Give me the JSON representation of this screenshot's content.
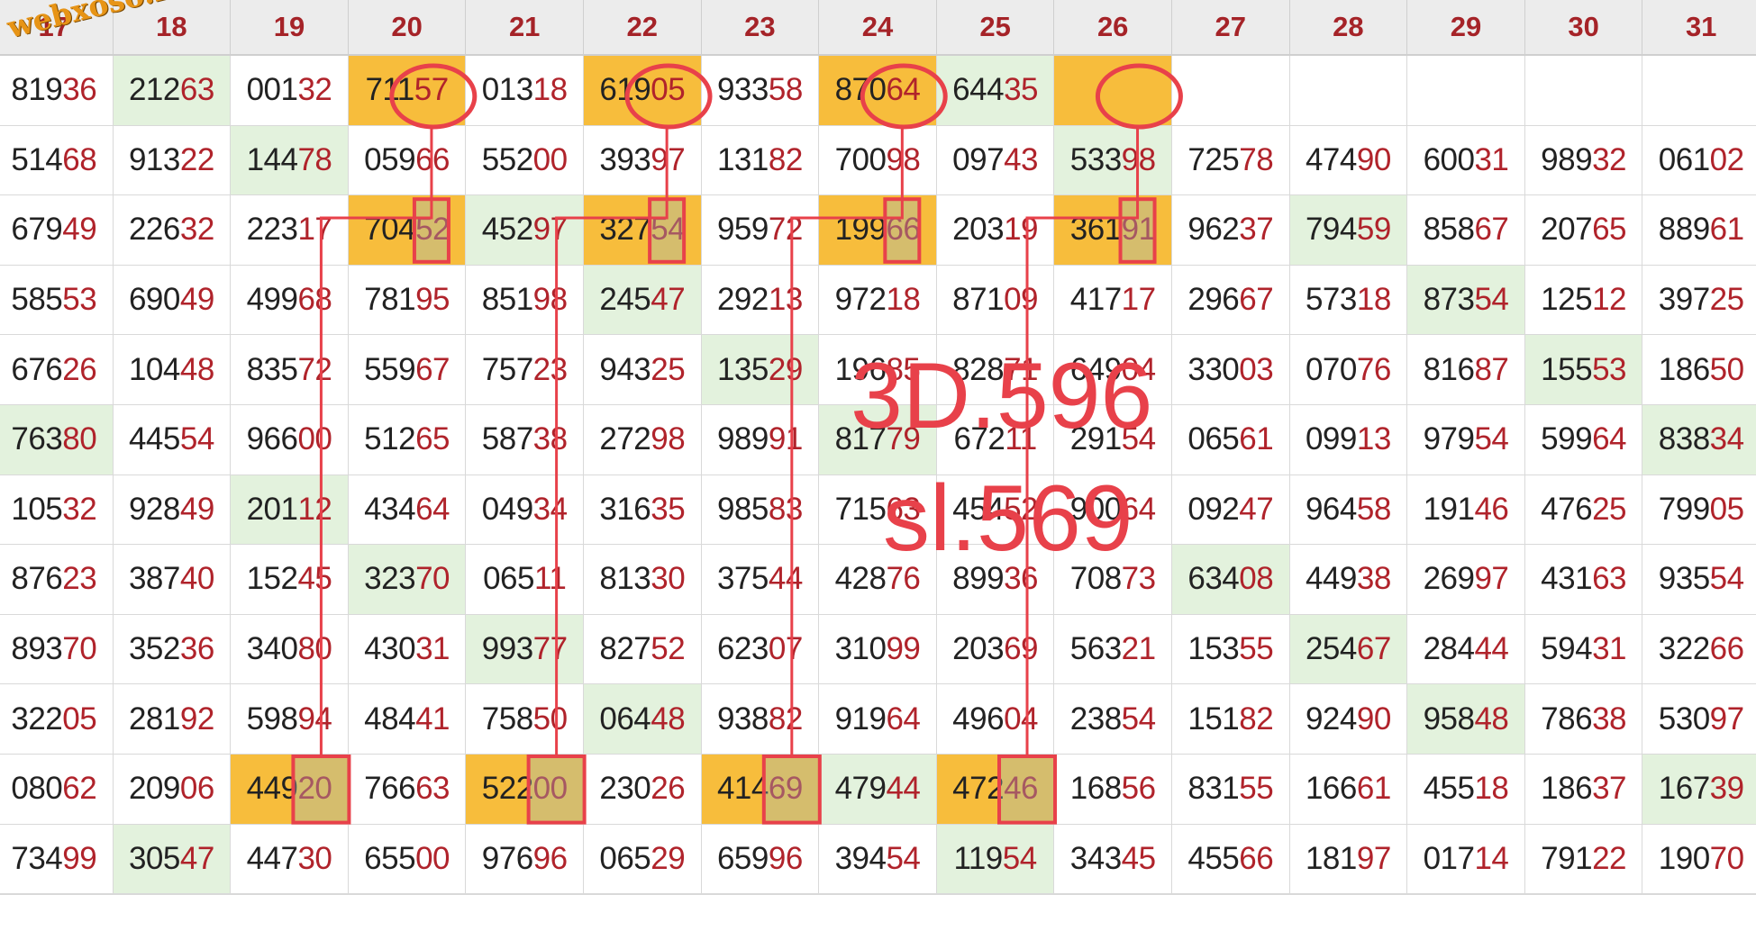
{
  "columns": [
    "17",
    "18",
    "19",
    "20",
    "21",
    "22",
    "23",
    "24",
    "25",
    "26",
    "27",
    "28",
    "29",
    "30",
    "31"
  ],
  "rows": [
    [
      "81936",
      "21263",
      "00132",
      "71157",
      "01318",
      "61905",
      "93358",
      "87064",
      "64435",
      "",
      "",
      "",
      "",
      "",
      ""
    ],
    [
      "51468",
      "91322",
      "14478",
      "05966",
      "55200",
      "39397",
      "13182",
      "70098",
      "09743",
      "53398",
      "72578",
      "47490",
      "60031",
      "98932",
      "06102"
    ],
    [
      "67949",
      "22632",
      "22317",
      "70452",
      "45297",
      "32754",
      "95972",
      "19966",
      "20319",
      "36191",
      "96237",
      "79459",
      "85867",
      "20765",
      "88961"
    ],
    [
      "58553",
      "69049",
      "49968",
      "78195",
      "85198",
      "24547",
      "29213",
      "97218",
      "87109",
      "41717",
      "29667",
      "57318",
      "87354",
      "12512",
      "39725"
    ],
    [
      "67626",
      "10448",
      "83572",
      "55967",
      "75723",
      "94325",
      "13529",
      "19685",
      "82871",
      "64904",
      "33003",
      "07076",
      "81687",
      "15553",
      "18650"
    ],
    [
      "76380",
      "44554",
      "96600",
      "51265",
      "58738",
      "27298",
      "98991",
      "81779",
      "67211",
      "29154",
      "06561",
      "09913",
      "97954",
      "59964",
      "83834"
    ],
    [
      "10532",
      "92849",
      "20112",
      "43464",
      "04934",
      "31635",
      "98583",
      "71563",
      "45452",
      "90064",
      "09247",
      "96458",
      "19146",
      "47625",
      "79905"
    ],
    [
      "87623",
      "38740",
      "15245",
      "32370",
      "06511",
      "81330",
      "37544",
      "42876",
      "89936",
      "70873",
      "63408",
      "44938",
      "26997",
      "43163",
      "93554"
    ],
    [
      "89370",
      "35236",
      "34080",
      "43031",
      "99377",
      "82752",
      "62307",
      "31099",
      "20369",
      "56321",
      "15355",
      "25467",
      "28444",
      "59431",
      "32266"
    ],
    [
      "32205",
      "28192",
      "59894",
      "48441",
      "75850",
      "06448",
      "93882",
      "91964",
      "49604",
      "23854",
      "15182",
      "92490",
      "95848",
      "78638",
      "53097"
    ],
    [
      "08062",
      "20906",
      "44920",
      "76663",
      "52200",
      "23026",
      "41469",
      "47944",
      "47246",
      "16856",
      "83155",
      "16661",
      "45518",
      "18637",
      "16739"
    ],
    [
      "73499",
      "30547",
      "44730",
      "65500",
      "97696",
      "06529",
      "65996",
      "39454",
      "11954",
      "34345",
      "45566",
      "18197",
      "01714",
      "79122",
      "19070"
    ]
  ],
  "highlights": {
    "green": [
      [
        0,
        1
      ],
      [
        0,
        8
      ],
      [
        1,
        2
      ],
      [
        1,
        9
      ],
      [
        2,
        4
      ],
      [
        2,
        11
      ],
      [
        3,
        5
      ],
      [
        3,
        12
      ],
      [
        4,
        6
      ],
      [
        4,
        13
      ],
      [
        5,
        0
      ],
      [
        5,
        7
      ],
      [
        5,
        14
      ],
      [
        6,
        2
      ],
      [
        7,
        3
      ],
      [
        7,
        10
      ],
      [
        8,
        4
      ],
      [
        8,
        11
      ],
      [
        9,
        5
      ],
      [
        9,
        12
      ],
      [
        10,
        7
      ],
      [
        10,
        14
      ],
      [
        11,
        1
      ],
      [
        11,
        8
      ]
    ],
    "gold": [
      [
        0,
        3
      ],
      [
        0,
        5
      ],
      [
        0,
        7
      ],
      [
        0,
        9
      ],
      [
        2,
        3
      ],
      [
        2,
        5
      ],
      [
        2,
        7
      ],
      [
        2,
        9
      ],
      [
        10,
        2
      ],
      [
        10,
        4
      ],
      [
        10,
        6
      ],
      [
        10,
        8
      ]
    ]
  },
  "colors": {
    "header_text": "#a52328",
    "tail_text": "#b0232b",
    "green_fill": "#e3f2dd",
    "gold_fill": "#f7bd3c",
    "annotation": "#e8414a",
    "watermark": "#e79416"
  },
  "annotation": {
    "line1": "3D.596",
    "line2": "sl.569"
  },
  "watermark": "webxoso.net",
  "marked_paths": [
    {
      "from": [
        0,
        3
      ],
      "via": [
        2,
        3
      ],
      "to": [
        10,
        2
      ]
    },
    {
      "from": [
        0,
        5
      ],
      "via": [
        2,
        5
      ],
      "to": [
        10,
        4
      ]
    },
    {
      "from": [
        0,
        7
      ],
      "via": [
        2,
        7
      ],
      "to": [
        10,
        6
      ]
    },
    {
      "from": [
        0,
        9
      ],
      "via": [
        2,
        9
      ],
      "to": [
        10,
        8
      ]
    }
  ]
}
